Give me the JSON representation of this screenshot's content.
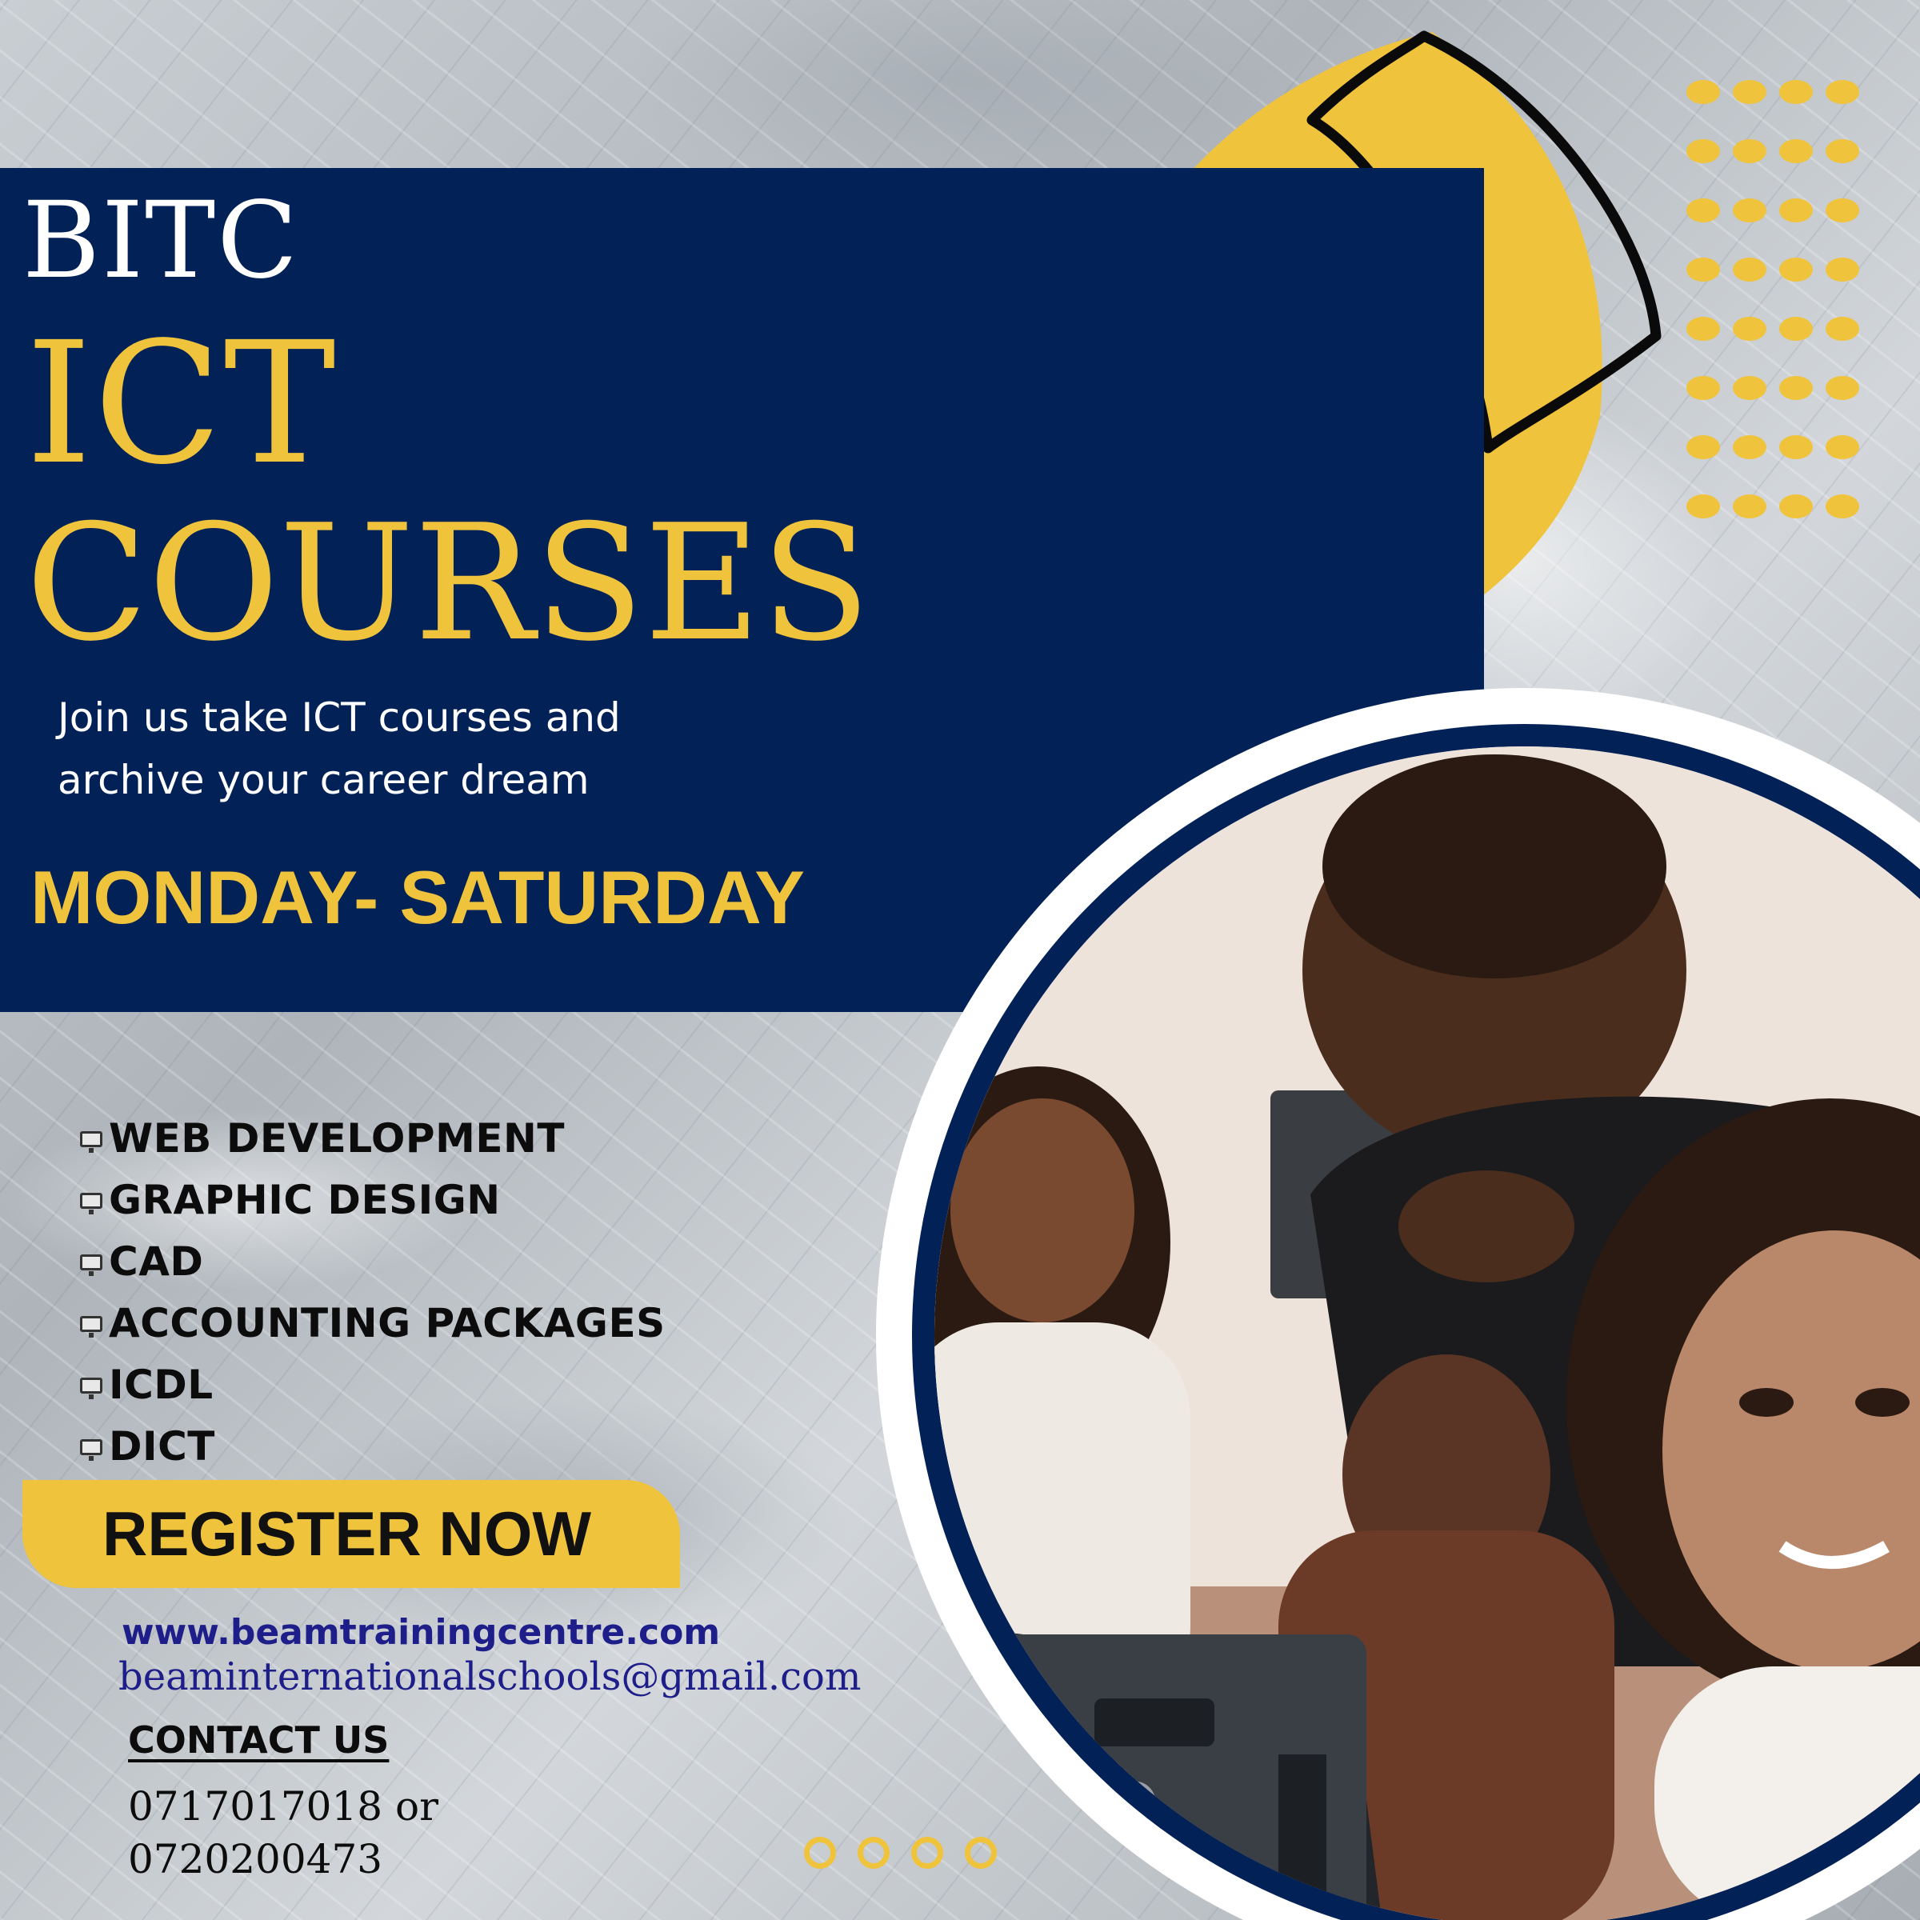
{
  "brand": "BITC",
  "title_line1": "ICT",
  "title_line2": "COURSES",
  "tagline_line1": "Join us take ICT courses and",
  "tagline_line2": "archive your career dream",
  "schedule": "MONDAY- SATURDAY",
  "courses": [
    "WEB DEVELOPMENT",
    "GRAPHIC DESIGN",
    "CAD",
    "ACCOUNTING PACKAGES",
    "ICDL",
    "DICT"
  ],
  "register_label": "REGISTER NOW",
  "website": "www.beamtrainingcentre.com",
  "email": "beaminternationalschools@gmail.com",
  "contact_heading": "CONTACT US",
  "phone_line1": "0717017018 or",
  "phone_line2": "0720200473",
  "photo_icon": "hp-logo-icon",
  "colors": {
    "navy": "#022157",
    "gold": "#f0c33c",
    "white": "#ffffff",
    "link_blue": "#1e1e8a"
  }
}
